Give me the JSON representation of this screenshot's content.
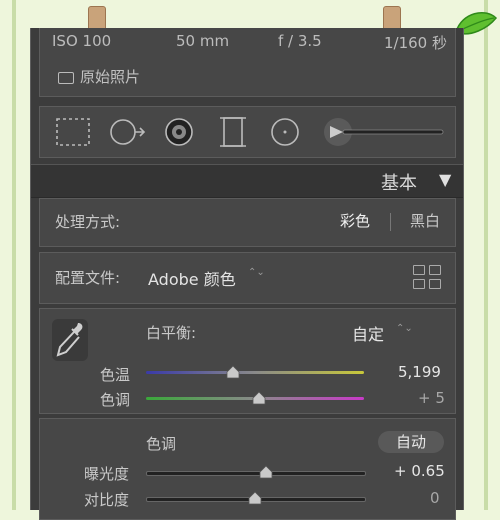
{
  "info": {
    "iso": "ISO 100",
    "focal": "50 mm",
    "aperture": "f / 3.5",
    "shutter": "1/160 秒",
    "original_photo_label": "原始照片"
  },
  "tools": [
    "crop-tool-icon",
    "spot-removal-icon",
    "redeye-icon",
    "graduated-filter-icon",
    "radial-filter-icon",
    "brush-icon"
  ],
  "basic": {
    "title": "基本",
    "arrow": "▼"
  },
  "treatment": {
    "label": "处理方式:",
    "color": "彩色",
    "bw": "黑白"
  },
  "profile": {
    "label": "配置文件:",
    "value": "Adobe 颜色",
    "chevron": "⌃⌄"
  },
  "white_balance": {
    "label": "白平衡:",
    "value": "自定",
    "chevron": "⌃⌄",
    "temp_label": "色温",
    "temp_value": "5,199",
    "temp_fraction": 0.4,
    "tint_label": "色调",
    "tint_value": "+ 5",
    "tint_fraction": 0.52
  },
  "tone": {
    "title": "色调",
    "auto_label": "自动",
    "exposure_label": "曝光度",
    "exposure_value": "+ 0.65",
    "exposure_fraction": 0.55,
    "contrast_label": "对比度",
    "contrast_value": "0",
    "contrast_fraction": 0.5
  },
  "colors": {
    "panel": "#3c3c3c",
    "section": "#474747",
    "page_bg": "#eef6dc"
  }
}
